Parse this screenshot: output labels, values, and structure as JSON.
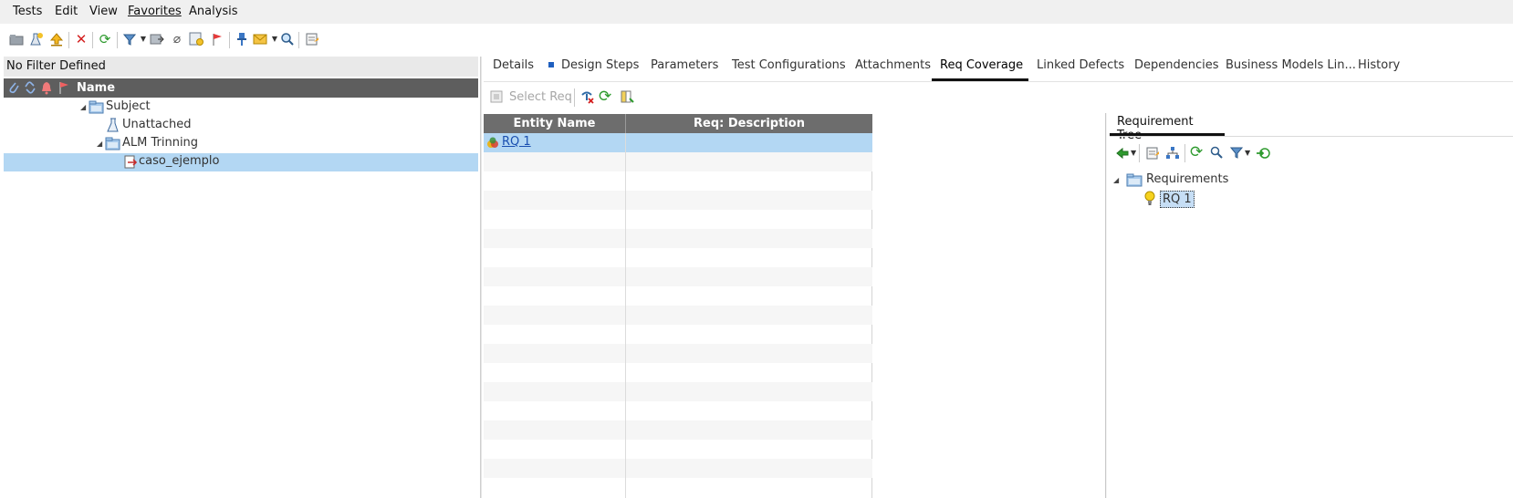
{
  "menu": [
    "Tests",
    "Edit",
    "View",
    "Favorites",
    "Analysis"
  ],
  "filter_bar": {
    "text": "No Filter Defined"
  },
  "tree": {
    "header": "Name",
    "nodes": [
      {
        "label": "Subject"
      },
      {
        "label": "Unattached"
      },
      {
        "label": "ALM Trinning"
      },
      {
        "label": "caso_ejemplo"
      }
    ]
  },
  "tabs": [
    {
      "label": "Details"
    },
    {
      "label": "Design Steps"
    },
    {
      "label": "Parameters"
    },
    {
      "label": "Test Configurations"
    },
    {
      "label": "Attachments"
    },
    {
      "label": "Req Coverage"
    },
    {
      "label": "Linked Defects"
    },
    {
      "label": "Dependencies"
    },
    {
      "label": "Business Models Lin..."
    },
    {
      "label": "History"
    }
  ],
  "active_tab": "Req Coverage",
  "coverage_toolbar": {
    "select_req": "Select Req"
  },
  "coverage_grid": {
    "columns": [
      "Entity Name",
      "Req: Description"
    ],
    "rows": [
      {
        "entity": "RQ 1",
        "description": ""
      }
    ]
  },
  "requirement_tree": {
    "tab_label": "Requirement Tree",
    "root": "Requirements",
    "child": "RQ 1"
  },
  "colors": {
    "selection": "#b3d7f3",
    "header": "#5e5e5e",
    "link": "#1a4fb0"
  }
}
